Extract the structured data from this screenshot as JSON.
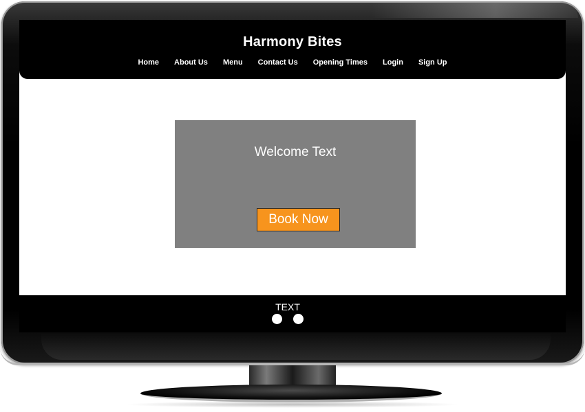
{
  "site": {
    "title": "Harmony Bites"
  },
  "nav": {
    "items": [
      {
        "label": "Home"
      },
      {
        "label": "About Us"
      },
      {
        "label": "Menu"
      },
      {
        "label": "Contact Us"
      },
      {
        "label": "Opening Times"
      },
      {
        "label": "Login"
      },
      {
        "label": "Sign Up"
      }
    ]
  },
  "hero": {
    "welcome_text": "Welcome Text",
    "book_button_label": "Book Now"
  },
  "footer": {
    "text": "TEXT",
    "carousel_dots": 2
  },
  "colors": {
    "header_bg": "#000000",
    "hero_bg": "#808080",
    "book_button_bg": "#f7941d",
    "text": "#ffffff"
  }
}
